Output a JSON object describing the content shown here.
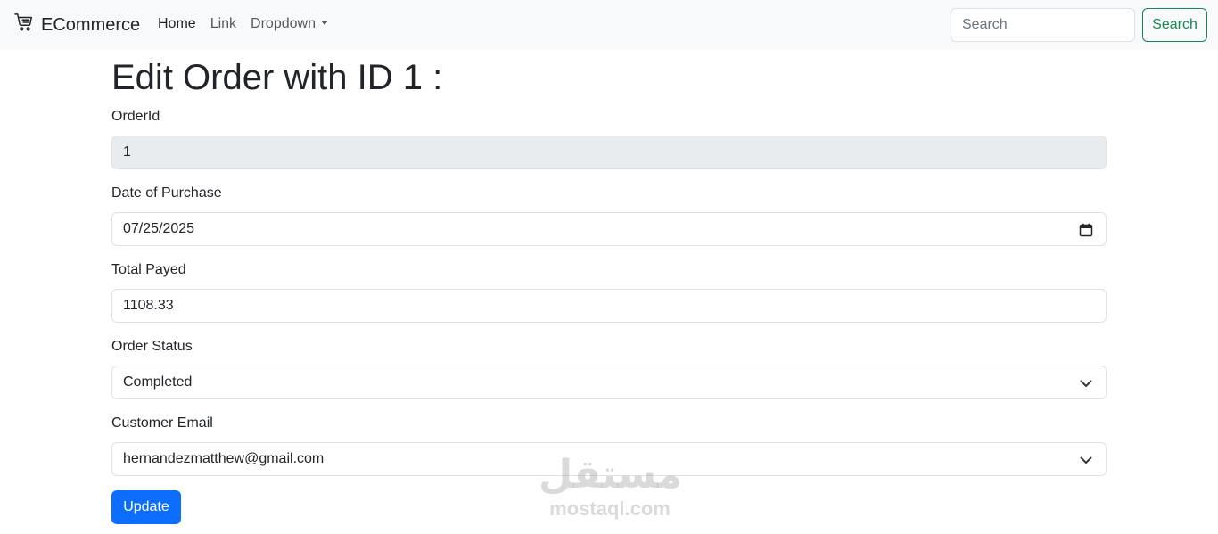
{
  "navbar": {
    "brand": "ECommerce",
    "links": [
      "Home",
      "Link",
      "Dropdown"
    ],
    "search_placeholder": "Search",
    "search_button": "Search"
  },
  "page": {
    "title": "Edit Order with ID 1 :"
  },
  "form": {
    "order_id_label": "OrderId",
    "order_id_value": "1",
    "date_label": "Date of Purchase",
    "date_value": "07/25/2025",
    "total_label": "Total Payed",
    "total_value": "1108.33",
    "status_label": "Order Status",
    "status_value": "Completed",
    "email_label": "Customer Email",
    "email_value": "hernandezmatthew@gmail.com",
    "submit_label": "Update"
  },
  "watermark": {
    "arabic": "مستقل",
    "latin": "mostaql.com"
  },
  "colors": {
    "primary": "#0d6efd",
    "success": "#198754",
    "navbar_bg": "#f8f9fa",
    "disabled_bg": "#e9ecef"
  },
  "icons": {
    "brand": "cart-icon",
    "date": "calendar-icon",
    "select": "chevron-down-icon"
  }
}
